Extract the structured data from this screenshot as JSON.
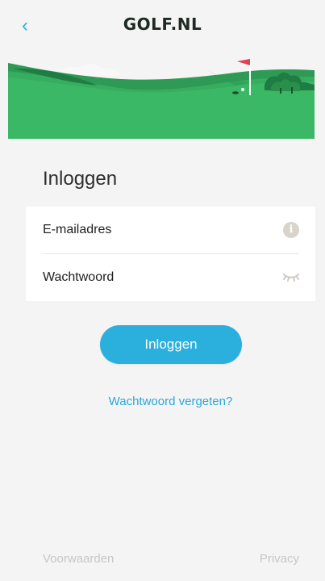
{
  "header": {
    "back_icon": "chevron-left-icon",
    "brand": "GOLF.NL"
  },
  "colors": {
    "accent": "#2bb0dd",
    "link": "#2aa8d8",
    "hero_green": "#33a85c",
    "hero_dark": "#1e7c42",
    "muted": "#c7c7c7"
  },
  "page": {
    "title": "Inloggen"
  },
  "form": {
    "email_label": "E-mailadres",
    "email_icon": "info-icon",
    "password_label": "Wachtwoord",
    "password_icon": "eye-closed-icon"
  },
  "actions": {
    "login_label": "Inloggen",
    "forgot_label": "Wachtwoord vergeten?"
  },
  "footer": {
    "terms_label": "Voorwaarden",
    "privacy_label": "Privacy"
  }
}
